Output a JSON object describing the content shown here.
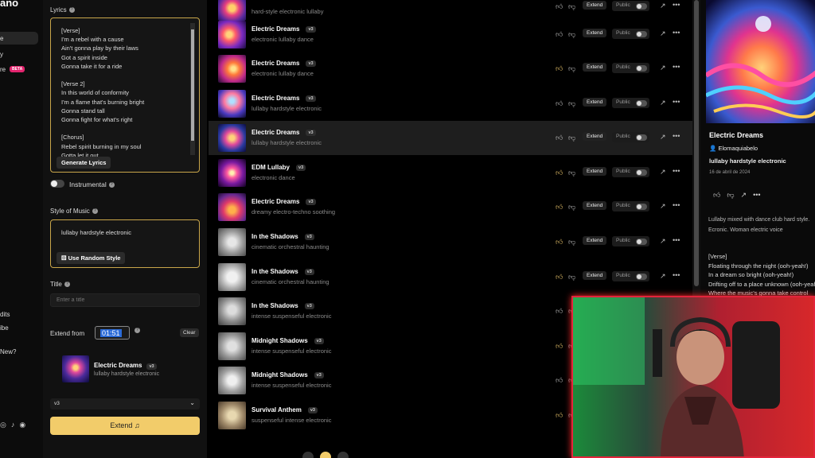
{
  "nav": {
    "logo": "ano",
    "items": [
      {
        "label": "e",
        "active": true
      },
      {
        "label": "y",
        "active": false
      },
      {
        "label": "re",
        "active": false
      },
      {
        "label": "dits",
        "active": false
      },
      {
        "label": "ibe",
        "active": false
      },
      {
        "label": "New?",
        "active": false
      }
    ],
    "beta": "BETA"
  },
  "create": {
    "lyrics_label": "Lyrics",
    "lyrics": "[Verse]\nI'm a rebel with a cause\nAin't gonna play by their laws\nGot a spirit inside\nGonna take it for a ride\n\n[Verse 2]\nIn this world of conformity\nI'm a flame that's burning bright\nGonna stand tall\nGonna fight for what's right\n\n[Chorus]\nRebel spirit burning in my soul\nGotta let it out",
    "generate_lyrics": "Generate Lyrics",
    "instrumental_label": "Instrumental",
    "style_label": "Style of Music",
    "style_value": "lullaby hardstyle electronic",
    "random_style": "Use Random Style",
    "title_label": "Title",
    "title_placeholder": "Enter a title",
    "extend_from_label": "Extend from",
    "extend_time": "01:51",
    "clear": "Clear",
    "extend_song": {
      "title": "Electric Dreams",
      "version": "v3",
      "tags": "lullaby hardstyle electronic"
    },
    "model": "v3",
    "extend_button": "Extend ♫"
  },
  "songs": [
    {
      "title": "",
      "version": "",
      "tags": "hard-style electronic lullaby",
      "liked": false,
      "extend": "Extend",
      "public": "Public"
    },
    {
      "title": "Electric Dreams",
      "version": "v3",
      "tags": "electronic lullaby dance",
      "liked": false,
      "extend": "Extend",
      "public": "Public"
    },
    {
      "title": "Electric Dreams",
      "version": "v3",
      "tags": "electronic lullaby dance",
      "liked": true,
      "extend": "Extend",
      "public": "Public"
    },
    {
      "title": "Electric Dreams",
      "version": "v3",
      "tags": "lullaby hardstyle electronic",
      "liked": false,
      "extend": "Extend",
      "public": "Public"
    },
    {
      "title": "Electric Dreams",
      "version": "v3",
      "tags": "lullaby hardstyle electronic",
      "liked": false,
      "extend": "Extend",
      "public": "Public"
    },
    {
      "title": "EDM Lullaby",
      "version": "v3",
      "tags": "electronic dance",
      "liked": true,
      "extend": "Extend",
      "public": "Public"
    },
    {
      "title": "Electric Dreams",
      "version": "v3",
      "tags": "dreamy electro-techno soothing",
      "liked": true,
      "extend": "Extend",
      "public": "Public"
    },
    {
      "title": "In the Shadows",
      "version": "v3",
      "tags": "cinematic orchestral haunting",
      "liked": true,
      "extend": "Extend",
      "public": "Public"
    },
    {
      "title": "In the Shadows",
      "version": "v3",
      "tags": "cinematic orchestral haunting",
      "liked": true,
      "extend": "Extend",
      "public": "Public"
    },
    {
      "title": "In the Shadows",
      "version": "v3",
      "tags": "intense suspenseful electronic",
      "liked": false,
      "extend": "",
      "public": ""
    },
    {
      "title": "Midnight Shadows",
      "version": "v3",
      "tags": "intense suspenseful electronic",
      "liked": true,
      "extend": "",
      "public": ""
    },
    {
      "title": "Midnight Shadows",
      "version": "v3",
      "tags": "intense suspenseful electronic",
      "liked": false,
      "extend": "",
      "public": ""
    },
    {
      "title": "Survival Anthem",
      "version": "v3",
      "tags": "suspenseful intense electronic",
      "liked": true,
      "extend": "",
      "public": ""
    }
  ],
  "detail": {
    "title": "Electric Dreams",
    "user": "Elomaquiabelo",
    "tags": "lullaby hardstyle electronic",
    "date": "16 de abril de 2024",
    "description": "Lullaby mixed with dance club hard style. Ecronic. Woman electric voice",
    "lyrics": "[Verse]\nFloating through the night (ooh-yeah!)\nIn a dream so bright (ooh-yeah!)\nDrifting off to a place unknown (ooh-yeah!)\nWhere the music's gonna take control"
  },
  "colors": {
    "accent": "#f2cc6a",
    "border_gold": "#c9a64a",
    "beta": "#e3246e",
    "cam_border": "#e3243b"
  }
}
